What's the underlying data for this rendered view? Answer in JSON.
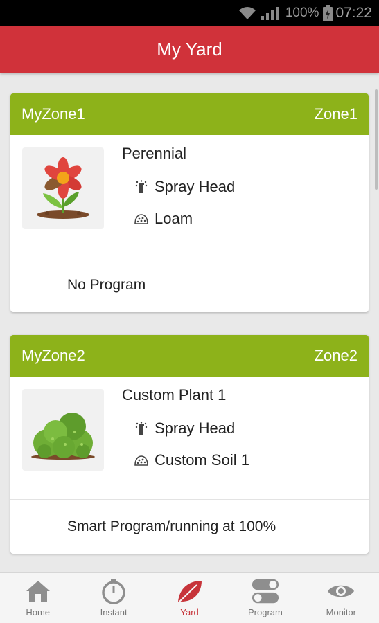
{
  "status": {
    "battery": "100%",
    "time": "07:22"
  },
  "header": {
    "title": "My Yard"
  },
  "zones": [
    {
      "name": "MyZone1",
      "id": "Zone1",
      "plant": "Perennial",
      "sprinkler": "Spray Head",
      "soil": "Loam",
      "program": "No Program"
    },
    {
      "name": "MyZone2",
      "id": "Zone2",
      "plant": "Custom Plant 1",
      "sprinkler": "Spray Head",
      "soil": "Custom Soil 1",
      "program": "Smart Program/running at 100%"
    }
  ],
  "nav": [
    {
      "label": "Home",
      "icon": "home-icon"
    },
    {
      "label": "Instant",
      "icon": "stopwatch-icon"
    },
    {
      "label": "Yard",
      "icon": "leaf-icon",
      "active": true
    },
    {
      "label": "Program",
      "icon": "toggle-icon"
    },
    {
      "label": "Monitor",
      "icon": "eye-icon"
    }
  ],
  "colors": {
    "appbar": "#d0323a",
    "zone_header": "#8db21a",
    "nav_active": "#c7343a"
  }
}
